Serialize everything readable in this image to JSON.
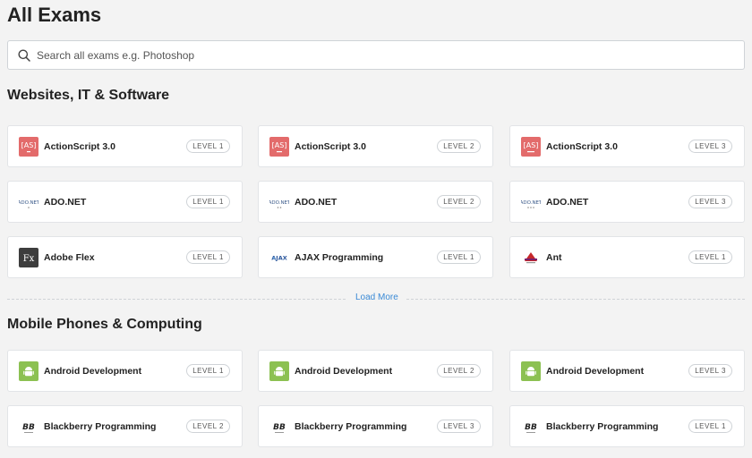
{
  "page": {
    "title": "All Exams"
  },
  "search": {
    "placeholder": "Search all exams e.g. Photoshop"
  },
  "sections": [
    {
      "title": "Websites, IT & Software",
      "load_more": "Load More",
      "cards": [
        {
          "name": "ActionScript 3.0",
          "level": "LEVEL 1",
          "icon": "actionscript-logo-icon"
        },
        {
          "name": "ActionScript 3.0",
          "level": "LEVEL 2",
          "icon": "actionscript-logo-icon"
        },
        {
          "name": "ActionScript 3.0",
          "level": "LEVEL 3",
          "icon": "actionscript-logo-icon"
        },
        {
          "name": "ADO.NET",
          "level": "LEVEL 1",
          "icon": "adonet-logo-icon"
        },
        {
          "name": "ADO.NET",
          "level": "LEVEL 2",
          "icon": "adonet-logo-icon"
        },
        {
          "name": "ADO.NET",
          "level": "LEVEL 3",
          "icon": "adonet-logo-icon"
        },
        {
          "name": "Adobe Flex",
          "level": "LEVEL 1",
          "icon": "adobe-flex-logo-icon"
        },
        {
          "name": "AJAX Programming",
          "level": "LEVEL 1",
          "icon": "ajax-logo-icon"
        },
        {
          "name": "Ant",
          "level": "LEVEL 1",
          "icon": "ant-logo-icon"
        }
      ]
    },
    {
      "title": "Mobile Phones & Computing",
      "cards": [
        {
          "name": "Android Development",
          "level": "LEVEL 1",
          "icon": "android-logo-icon"
        },
        {
          "name": "Android Development",
          "level": "LEVEL 2",
          "icon": "android-logo-icon"
        },
        {
          "name": "Android Development",
          "level": "LEVEL 3",
          "icon": "android-logo-icon"
        },
        {
          "name": "Blackberry Programming",
          "level": "LEVEL 2",
          "icon": "blackberry-logo-icon"
        },
        {
          "name": "Blackberry Programming",
          "level": "LEVEL 3",
          "icon": "blackberry-logo-icon"
        },
        {
          "name": "Blackberry Programming",
          "level": "LEVEL 1",
          "icon": "blackberry-logo-icon"
        }
      ]
    }
  ],
  "colors": {
    "background": "#f3f3f3",
    "link": "#3a8ad6",
    "actionscript": "#e36b6b",
    "android": "#8cc152",
    "flex": "#3d3d3d"
  }
}
